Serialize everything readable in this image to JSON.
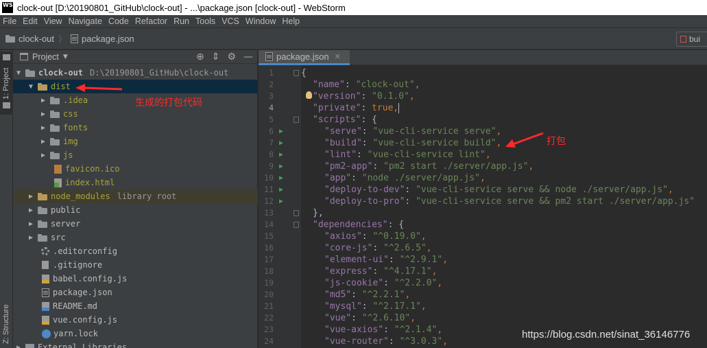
{
  "window": {
    "logo": "WS",
    "title": "clock-out [D:\\20190801_GitHub\\clock-out] - ...\\package.json [clock-out] - WebStorm"
  },
  "menu": [
    "File",
    "Edit",
    "View",
    "Navigate",
    "Code",
    "Refactor",
    "Run",
    "Tools",
    "VCS",
    "Window",
    "Help"
  ],
  "navbar": {
    "crumbs": [
      "clock-out",
      "package.json"
    ],
    "build_button": "bui"
  },
  "tool_strip": {
    "project_tab": "1: Project",
    "structure_tab": "Z: Structure"
  },
  "project_panel": {
    "title": "Project",
    "tree": [
      {
        "name": "clock-out",
        "extra": "D:\\20190801_GitHub\\clock-out"
      },
      {
        "name": "dist"
      },
      {
        "name": ".idea"
      },
      {
        "name": "css"
      },
      {
        "name": "fonts"
      },
      {
        "name": "img"
      },
      {
        "name": "js"
      },
      {
        "name": "favicon.ico"
      },
      {
        "name": "index.html"
      },
      {
        "name": "node_modules",
        "extra": "library root"
      },
      {
        "name": "public"
      },
      {
        "name": "server"
      },
      {
        "name": "src"
      },
      {
        "name": ".editorconfig"
      },
      {
        "name": ".gitignore"
      },
      {
        "name": "babel.config.js"
      },
      {
        "name": "package.json"
      },
      {
        "name": "README.md"
      },
      {
        "name": "vue.config.js"
      },
      {
        "name": "yarn.lock"
      },
      {
        "name": "External Libraries"
      }
    ]
  },
  "editor": {
    "tab": "package.json",
    "lines": [
      {
        "n": "1",
        "parts": []
      },
      {
        "n": "2",
        "parts": [
          "\"name\"",
          ": ",
          "\"clock-out\"",
          ","
        ]
      },
      {
        "n": "3",
        "parts": [
          "\"version\"",
          ": ",
          "\"0.1.0\"",
          ","
        ]
      },
      {
        "n": "4",
        "parts": [
          "\"private\"",
          ": ",
          "true",
          ","
        ]
      },
      {
        "n": "5",
        "parts": [
          "\"scripts\"",
          ": {"
        ]
      },
      {
        "n": "6",
        "parts": [
          "\"serve\"",
          ": ",
          "\"vue-cli-service serve\"",
          ","
        ]
      },
      {
        "n": "7",
        "parts": [
          "\"build\"",
          ": ",
          "\"vue-cli-service build\"",
          ","
        ]
      },
      {
        "n": "8",
        "parts": [
          "\"lint\"",
          ": ",
          "\"vue-cli-service lint\"",
          ","
        ]
      },
      {
        "n": "9",
        "parts": [
          "\"pm2-app\"",
          ": ",
          "\"pm2 start ./server/app.js\"",
          ","
        ]
      },
      {
        "n": "10",
        "parts": [
          "\"app\"",
          ": ",
          "\"node ./server/app.js\"",
          ","
        ]
      },
      {
        "n": "11",
        "parts": [
          "\"deploy-to-dev\"",
          ": ",
          "\"vue-cli-service serve && node ./server/app.js\"",
          ","
        ]
      },
      {
        "n": "12",
        "parts": [
          "\"deploy-to-pro\"",
          ": ",
          "\"vue-cli-service serve && pm2 start ./server/app.js\"",
          ""
        ]
      },
      {
        "n": "13",
        "parts": [
          "},"
        ]
      },
      {
        "n": "14",
        "parts": [
          "\"dependencies\"",
          ": {"
        ]
      },
      {
        "n": "15",
        "parts": [
          "\"axios\"",
          ": ",
          "\"^0.19.0\"",
          ","
        ]
      },
      {
        "n": "16",
        "parts": [
          "\"core-js\"",
          ": ",
          "\"^2.6.5\"",
          ","
        ]
      },
      {
        "n": "17",
        "parts": [
          "\"element-ui\"",
          ": ",
          "\"^2.9.1\"",
          ","
        ]
      },
      {
        "n": "18",
        "parts": [
          "\"express\"",
          ": ",
          "\"^4.17.1\"",
          ","
        ]
      },
      {
        "n": "19",
        "parts": [
          "\"js-cookie\"",
          ": ",
          "\"^2.2.0\"",
          ","
        ]
      },
      {
        "n": "20",
        "parts": [
          "\"md5\"",
          ": ",
          "\"^2.2.1\"",
          ","
        ]
      },
      {
        "n": "21",
        "parts": [
          "\"mysql\"",
          ": ",
          "\"^2.17.1\"",
          ","
        ]
      },
      {
        "n": "22",
        "parts": [
          "\"vue\"",
          ": ",
          "\"^2.6.10\"",
          ","
        ]
      },
      {
        "n": "23",
        "parts": [
          "\"vue-axios\"",
          ": ",
          "\"^2.1.4\"",
          ","
        ]
      },
      {
        "n": "24",
        "parts": [
          "\"vue-router\"",
          ": ",
          "\"^3.0.3\"",
          ","
        ]
      }
    ],
    "first_line_text": "{"
  },
  "annotations": {
    "dist_note": "生成的打包代码",
    "build_note": "打包"
  },
  "watermark": "https://blog.csdn.net/sinat_36146776",
  "colors": {
    "key": "#9876aa",
    "string": "#6a8759",
    "keyword": "#cc7832",
    "annotation": "#ff2a2a",
    "selection": "#0d293e"
  }
}
